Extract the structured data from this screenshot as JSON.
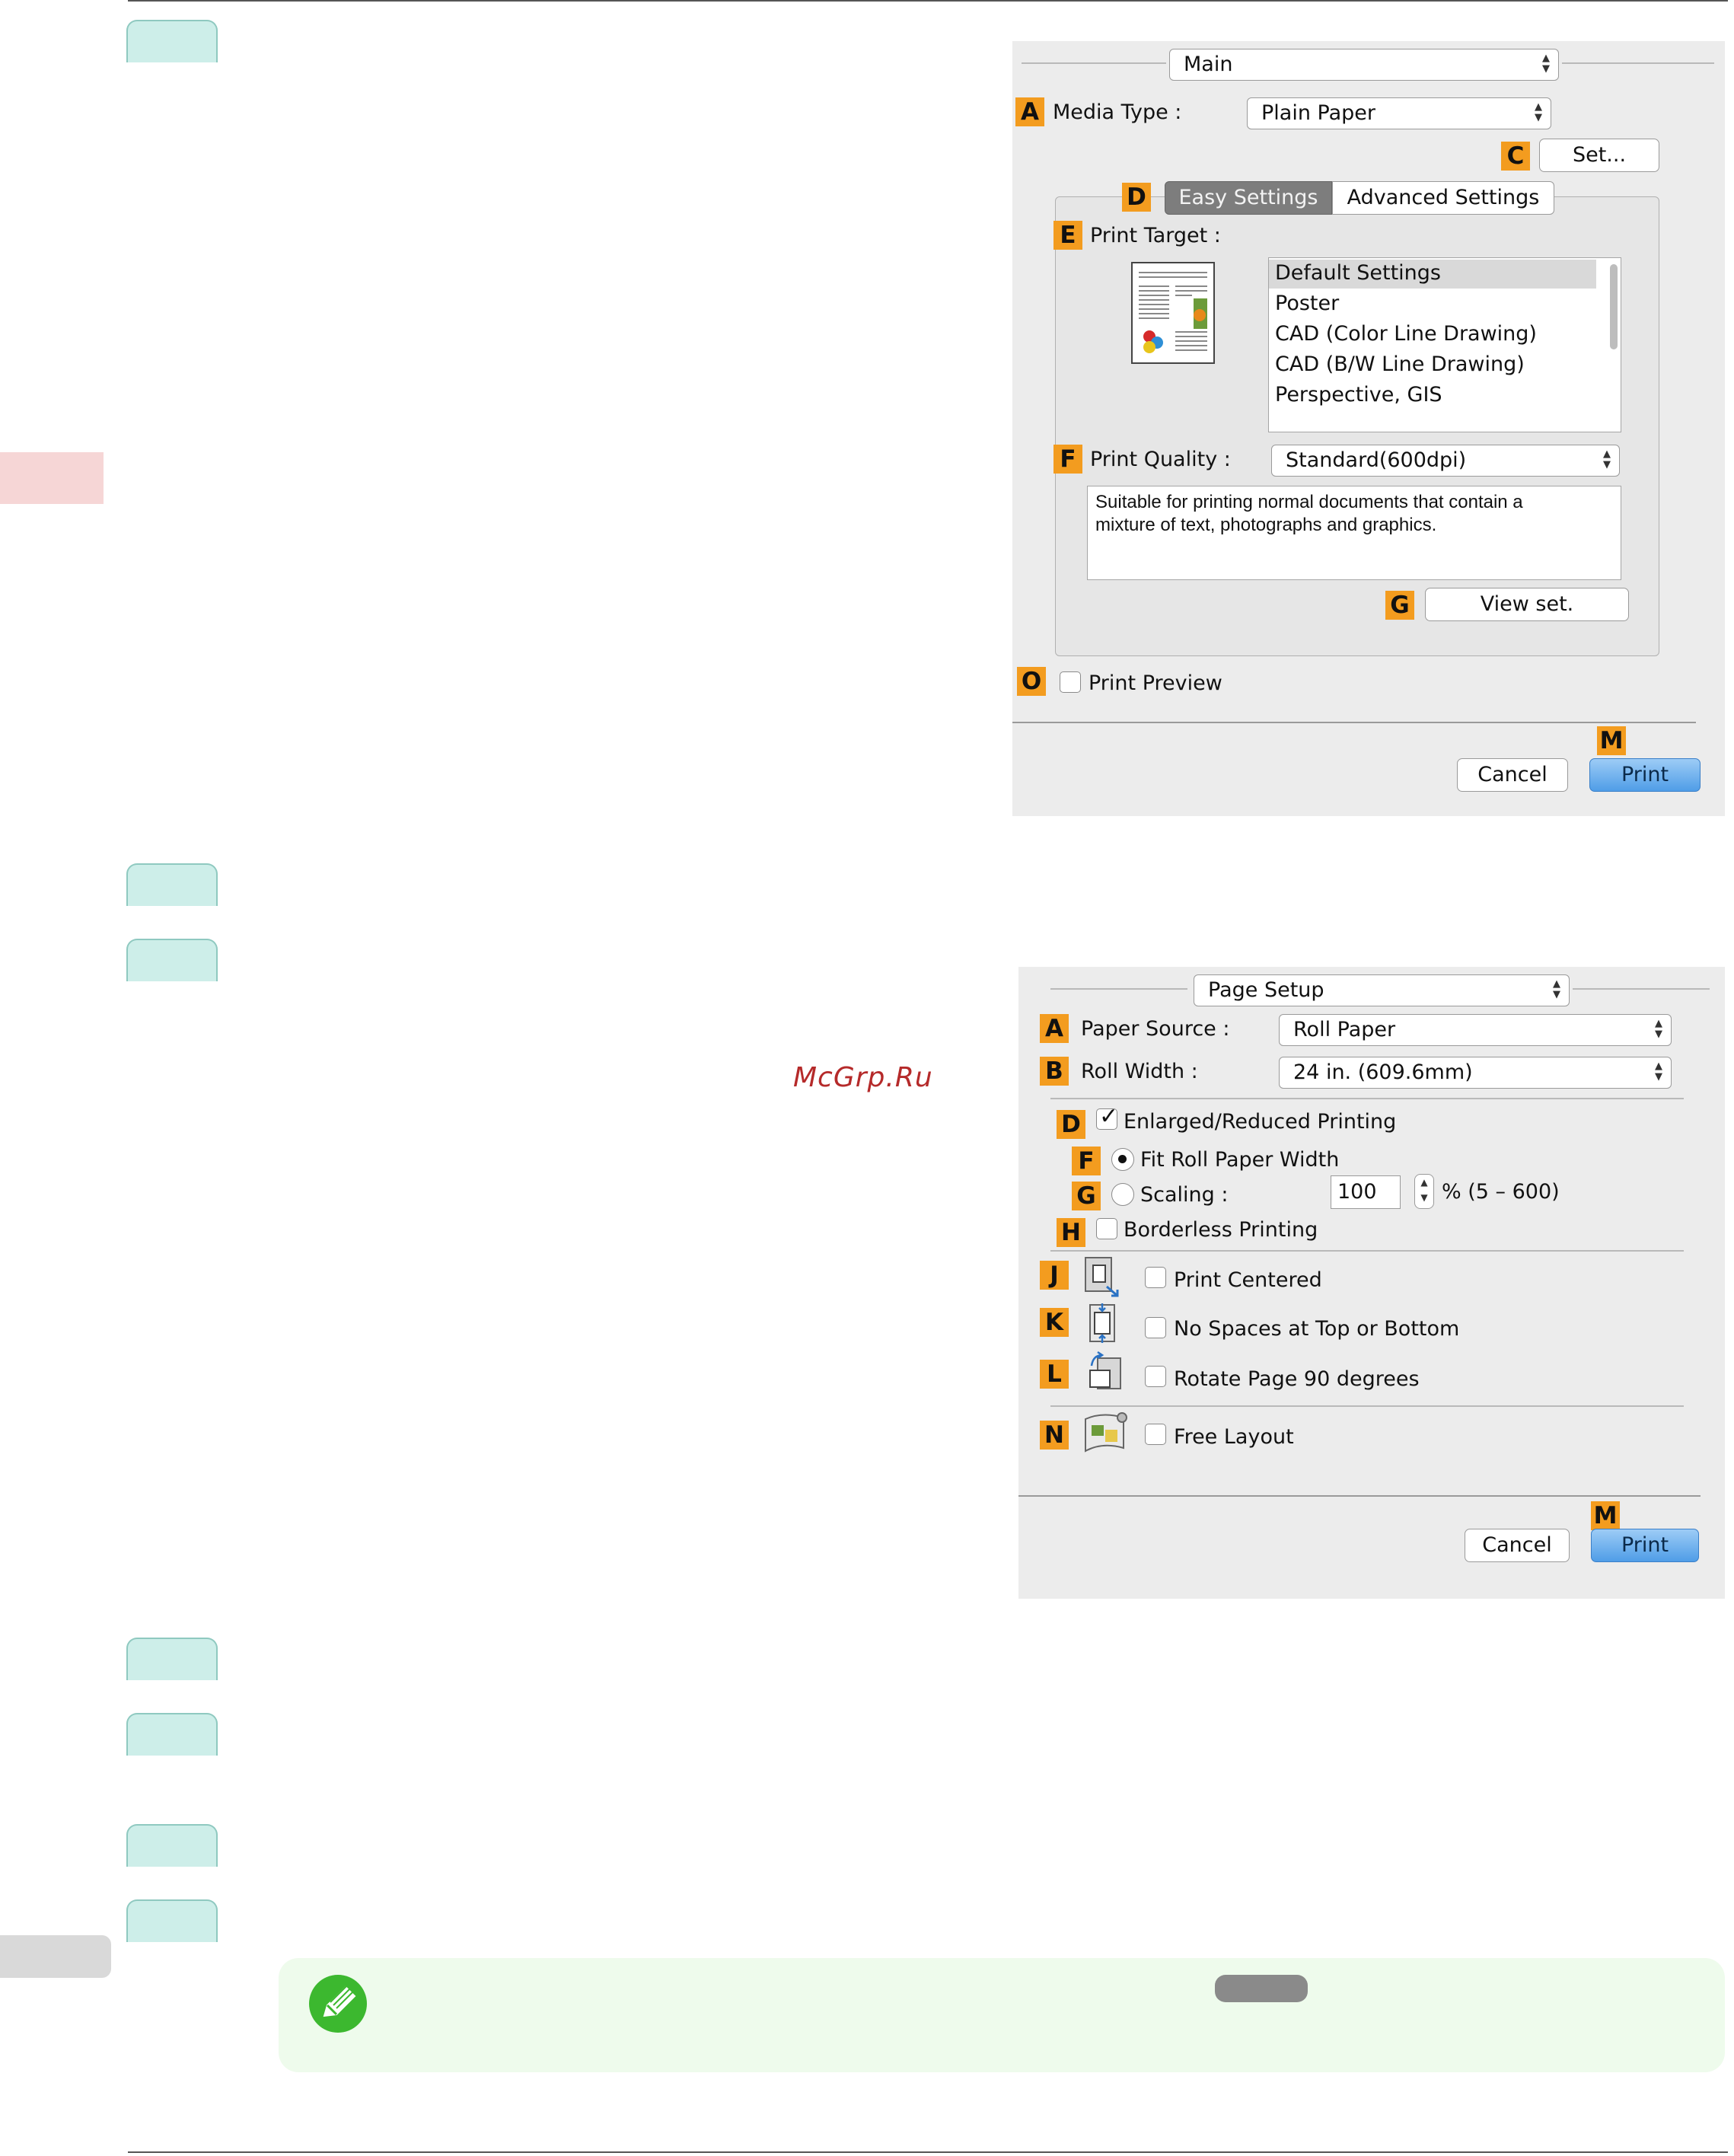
{
  "watermark": "McGrp.Ru",
  "dialog_main": {
    "popup": "Main",
    "media_type_label": "Media Type :",
    "media_type_value": "Plain Paper",
    "set_button": "Set...",
    "tabs": [
      "Easy Settings",
      "Advanced Settings"
    ],
    "print_target_label": "Print Target :",
    "print_target_options": [
      "Default Settings",
      "Poster",
      "CAD (Color Line Drawing)",
      "CAD (B/W Line Drawing)",
      "Perspective, GIS"
    ],
    "print_quality_label": "Print Quality :",
    "print_quality_value": "Standard(600dpi)",
    "description": "Suitable for printing normal documents that contain a mixture of text, photographs and graphics.",
    "view_set_button": "View set.",
    "print_preview_label": "Print Preview",
    "cancel_button": "Cancel",
    "print_button": "Print",
    "letters": {
      "A": "A",
      "C": "C",
      "D": "D",
      "E": "E",
      "F": "F",
      "G": "G",
      "O": "O",
      "M": "M"
    }
  },
  "dialog_page_setup": {
    "popup": "Page Setup",
    "paper_source_label": "Paper Source :",
    "paper_source_value": "Roll Paper",
    "roll_width_label": "Roll Width :",
    "roll_width_value": "24 in. (609.6mm)",
    "enlarged_label": "Enlarged/Reduced Printing",
    "fit_roll_label": "Fit Roll Paper Width",
    "scaling_label": "Scaling :",
    "scaling_value": "100",
    "scaling_range": "% (5 – 600)",
    "borderless_label": "Borderless Printing",
    "print_centered_label": "Print Centered",
    "no_spaces_label": "No Spaces at Top or Bottom",
    "rotate_label": "Rotate Page 90 degrees",
    "free_layout_label": "Free Layout",
    "cancel_button": "Cancel",
    "print_button": "Print",
    "letters": {
      "A": "A",
      "B": "B",
      "D": "D",
      "F": "F",
      "G": "G",
      "H": "H",
      "J": "J",
      "K": "K",
      "L": "L",
      "N": "N",
      "M": "M"
    }
  },
  "colors": {
    "step_tab": "#cdeee9",
    "side_tab": "#f6d6d6",
    "letter_badge": "#f39c1f",
    "note_bg": "#eefbec",
    "note_icon": "#3cb82f",
    "print_button": "#4f9de7"
  }
}
